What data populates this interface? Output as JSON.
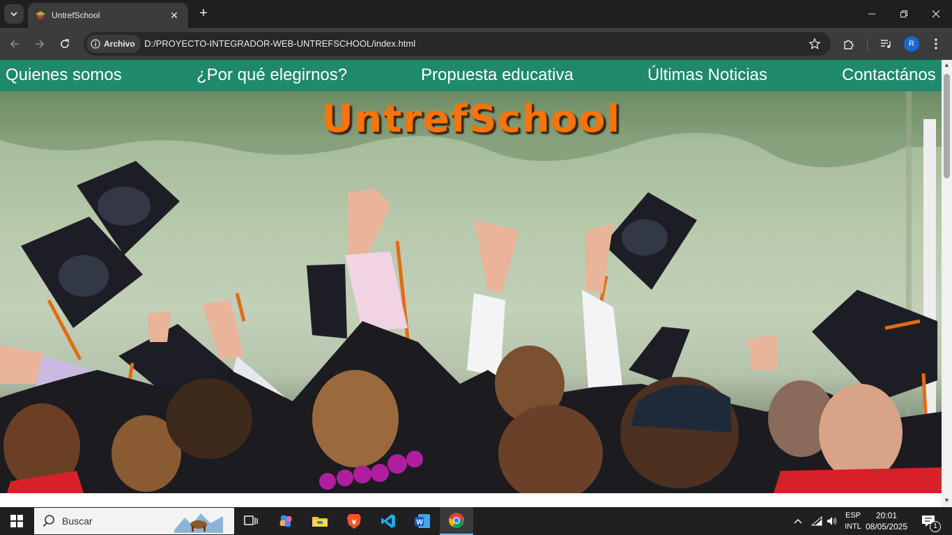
{
  "browser": {
    "tab_title": "UntrefSchool",
    "security_chip": "Archivo",
    "url": "D:/PROYECTO-INTEGRADOR-WEB-UNTREFSCHOOL/index.html",
    "profile_initial": "R"
  },
  "page": {
    "nav": [
      {
        "label": "Quienes somos"
      },
      {
        "label": "¿Por qué elegirnos?"
      },
      {
        "label": "Propuesta educativa"
      },
      {
        "label": "Últimas Noticias"
      },
      {
        "label": "Contactános"
      }
    ],
    "brand": "UntrefSchool",
    "hero_image": "graduates-throwing-caps-photo"
  },
  "taskbar": {
    "search_label": "Buscar",
    "apps": [
      "task-view",
      "copilot",
      "file-explorer",
      "brave",
      "vscode",
      "word",
      "chrome"
    ],
    "lang_line1": "ESP",
    "lang_line2": "INTL",
    "time": "20:01",
    "date": "08/05/2025",
    "notification_count": "1"
  },
  "colors": {
    "nav_bg": "#1e8a6b",
    "brand_color": "#f7730c"
  }
}
